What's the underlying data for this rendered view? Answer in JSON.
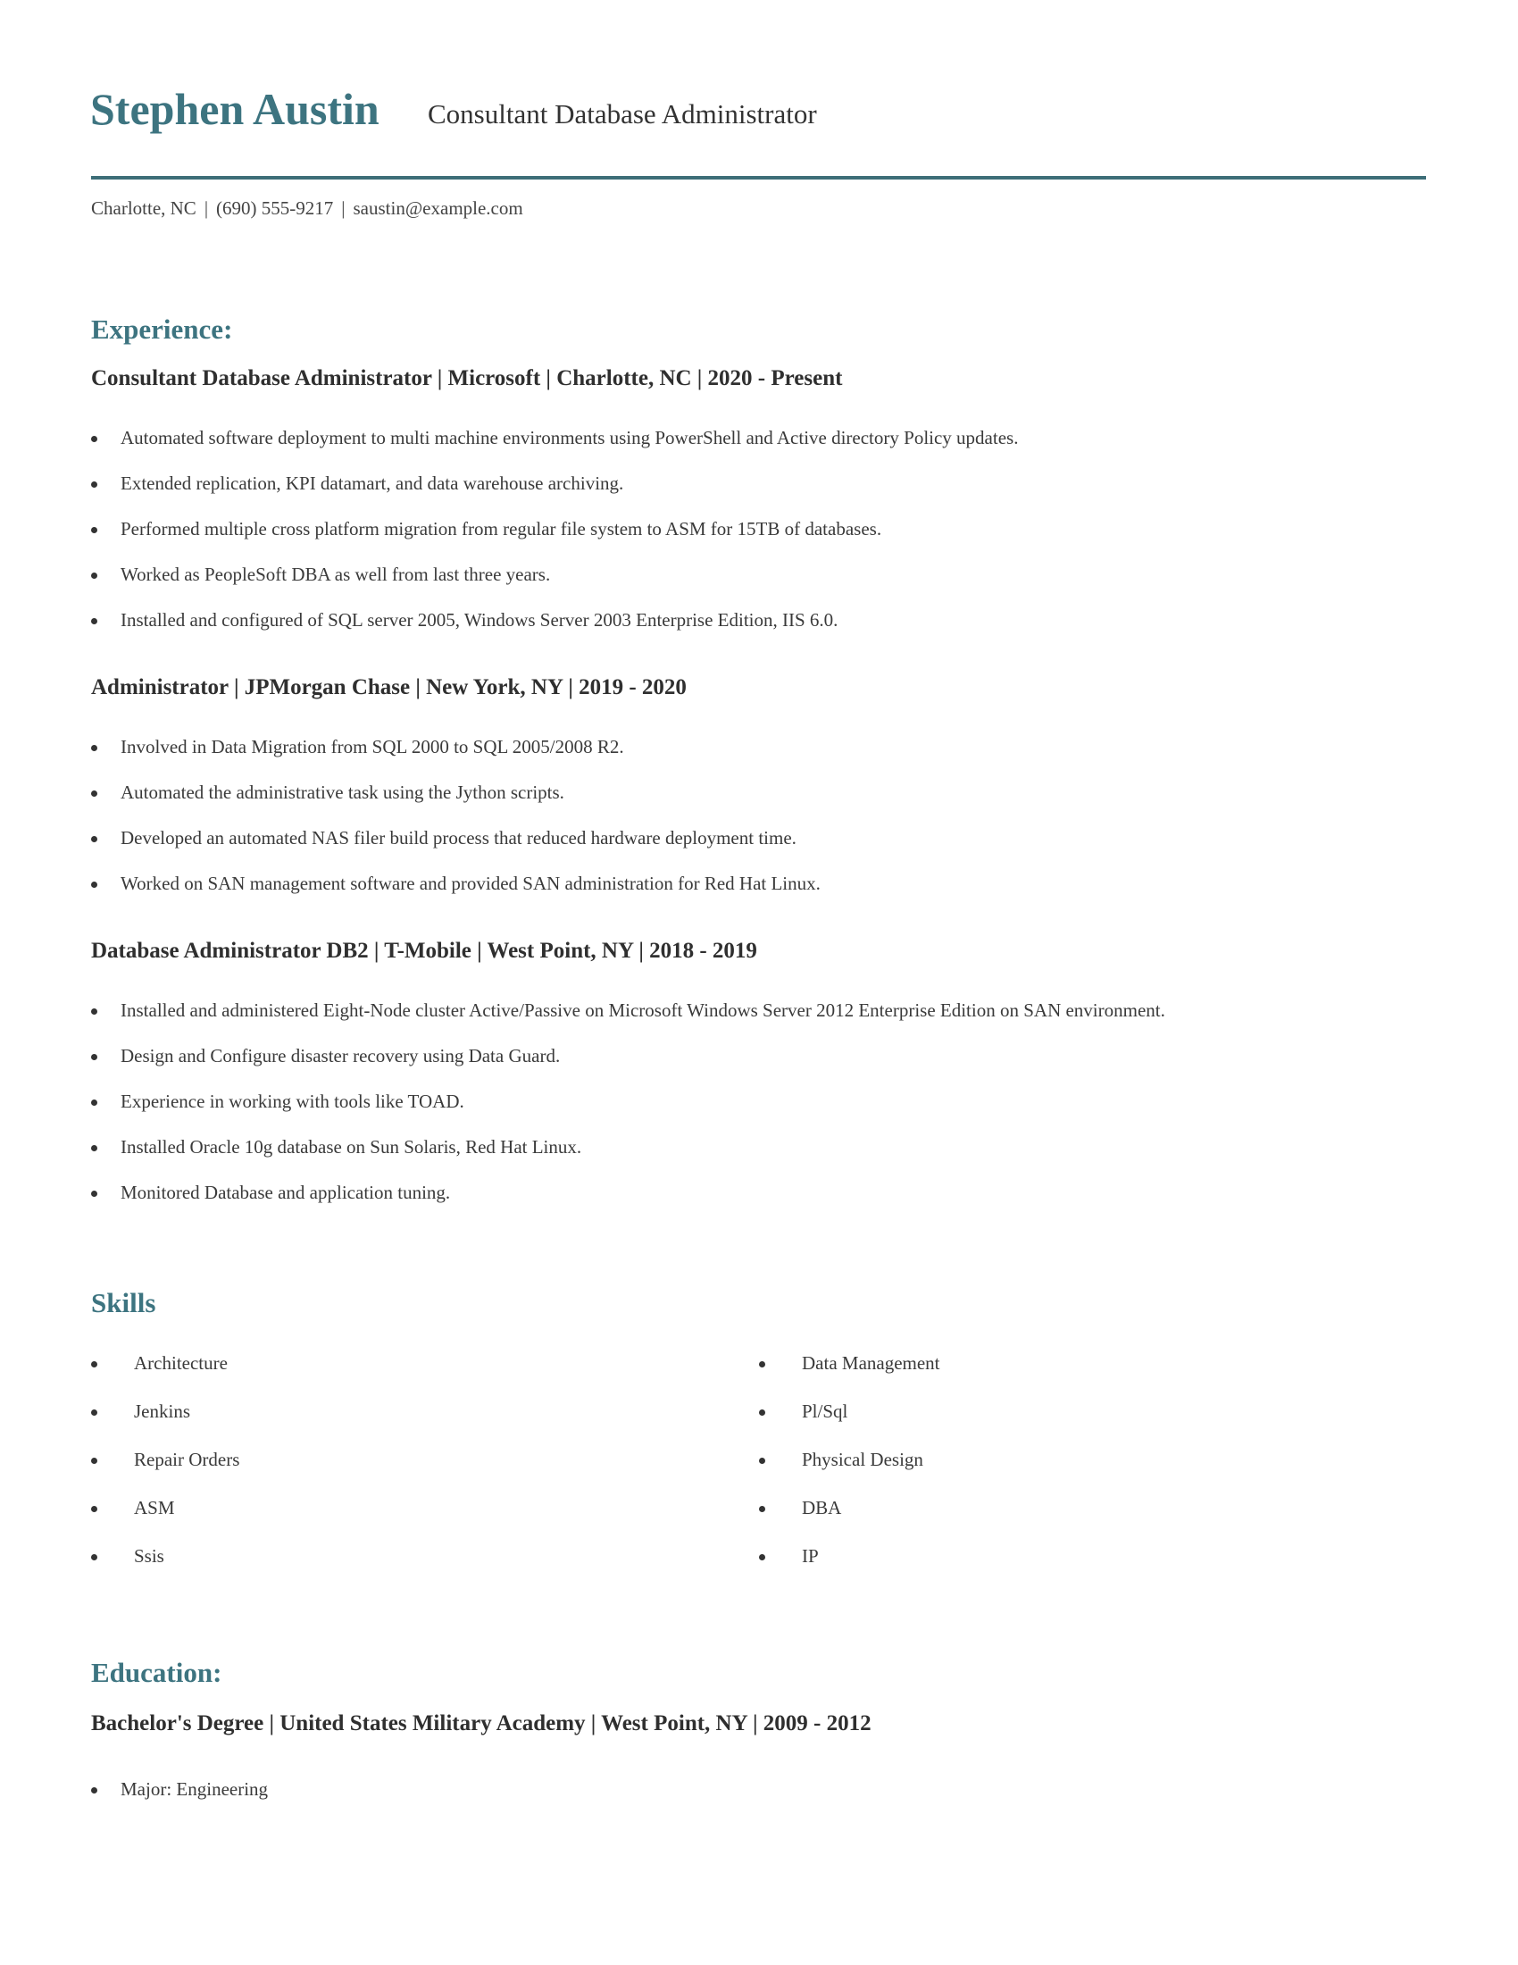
{
  "header": {
    "name": "Stephen Austin",
    "title": "Consultant Database Administrator",
    "contact": {
      "location": "Charlotte, NC",
      "separator": "|",
      "phone": "(690) 555-9217",
      "email": "saustin@example.com"
    },
    "accent_color": "#3d7480"
  },
  "experience": {
    "heading": "Experience:",
    "jobs": [
      {
        "title": "Consultant Database Administrator | Microsoft | Charlotte, NC |  2020 - Present",
        "bullets": [
          "Automated software deployment to multi machine environments using PowerShell and Active directory Policy updates.",
          "Extended replication, KPI datamart, and data warehouse archiving.",
          "Performed multiple cross platform migration from regular file system to ASM for 15TB of databases.",
          "Worked as PeopleSoft DBA as well from last three years.",
          "Installed and configured of SQL server 2005, Windows Server 2003 Enterprise Edition, IIS 6.0."
        ]
      },
      {
        "title": "Administrator | JPMorgan Chase | New York, NY |  2019 - 2020",
        "bullets": [
          "Involved in Data Migration from SQL 2000 to SQL 2005/2008 R2.",
          "Automated the administrative task using the Jython scripts.",
          "Developed an automated NAS filer build process that reduced hardware deployment time.",
          "Worked on SAN management software and provided SAN administration for Red Hat Linux."
        ]
      },
      {
        "title": "Database Administrator DB2 | T-Mobile | West Point, NY |  2018 - 2019",
        "bullets": [
          "Installed and administered Eight-Node cluster Active/Passive on Microsoft Windows Server 2012 Enterprise Edition on SAN environment.",
          "Design and Configure disaster recovery using Data Guard.",
          "Experience in working with tools like TOAD.",
          "Installed Oracle 10g database on Sun Solaris, Red Hat Linux.",
          "Monitored Database and application tuning."
        ]
      }
    ]
  },
  "skills": {
    "heading": "Skills",
    "left": [
      "Architecture",
      "Jenkins",
      "Repair Orders",
      "ASM",
      "Ssis"
    ],
    "right": [
      "Data Management",
      "Pl/Sql",
      "Physical Design",
      "DBA",
      "IP"
    ]
  },
  "education": {
    "heading": "Education:",
    "entries": [
      {
        "title": "Bachelor's Degree | United States Military Academy | West Point, NY |  2009 - 2012",
        "bullets": [
          "Major: Engineering"
        ]
      }
    ]
  }
}
